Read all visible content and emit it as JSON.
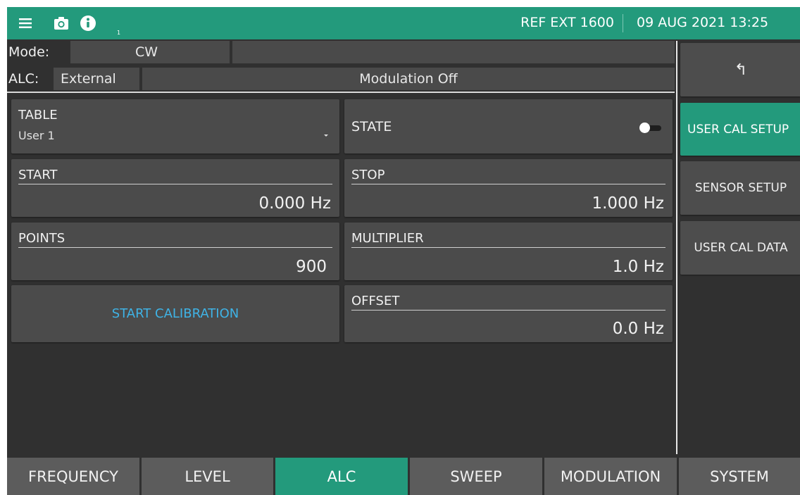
{
  "topbar": {
    "ref_status": "REF EXT 1600",
    "datetime": "09 AUG 2021 13:25",
    "info_subscript": "1",
    "icons": [
      "menu-icon",
      "camera-icon",
      "info-icon"
    ]
  },
  "header": {
    "mode_label": "Mode:",
    "mode_value": "CW",
    "alc_label": "ALC:",
    "alc_value": "External",
    "modulation_status": "Modulation Off"
  },
  "main": {
    "table": {
      "label": "TABLE",
      "value": "User 1"
    },
    "state": {
      "label": "STATE",
      "on": false
    },
    "start": {
      "label": "START",
      "value": "0.000 Hz"
    },
    "stop": {
      "label": "STOP",
      "value": "1.000 Hz"
    },
    "points": {
      "label": "POINTS",
      "value": "900"
    },
    "multiplier": {
      "label": "MULTIPLIER",
      "value": "1.0 Hz"
    },
    "start_calibration": "START CALIBRATION",
    "offset": {
      "label": "OFFSET",
      "value": "0.0 Hz"
    }
  },
  "side_menu": {
    "back_glyph": "↰",
    "items": [
      {
        "label": "USER CAL SETUP",
        "active": true
      },
      {
        "label": "SENSOR SETUP",
        "active": false
      },
      {
        "label": "USER CAL DATA",
        "active": false
      }
    ]
  },
  "tabs": [
    {
      "label": "FREQUENCY",
      "active": false
    },
    {
      "label": "LEVEL",
      "active": false
    },
    {
      "label": "ALC",
      "active": true
    },
    {
      "label": "SWEEP",
      "active": false
    },
    {
      "label": "MODULATION",
      "active": false
    },
    {
      "label": "SYSTEM",
      "active": false
    }
  ],
  "colors": {
    "accent": "#239a7c",
    "background": "#303030",
    "tile": "#4b4b4b",
    "link": "#3fb3e6"
  }
}
